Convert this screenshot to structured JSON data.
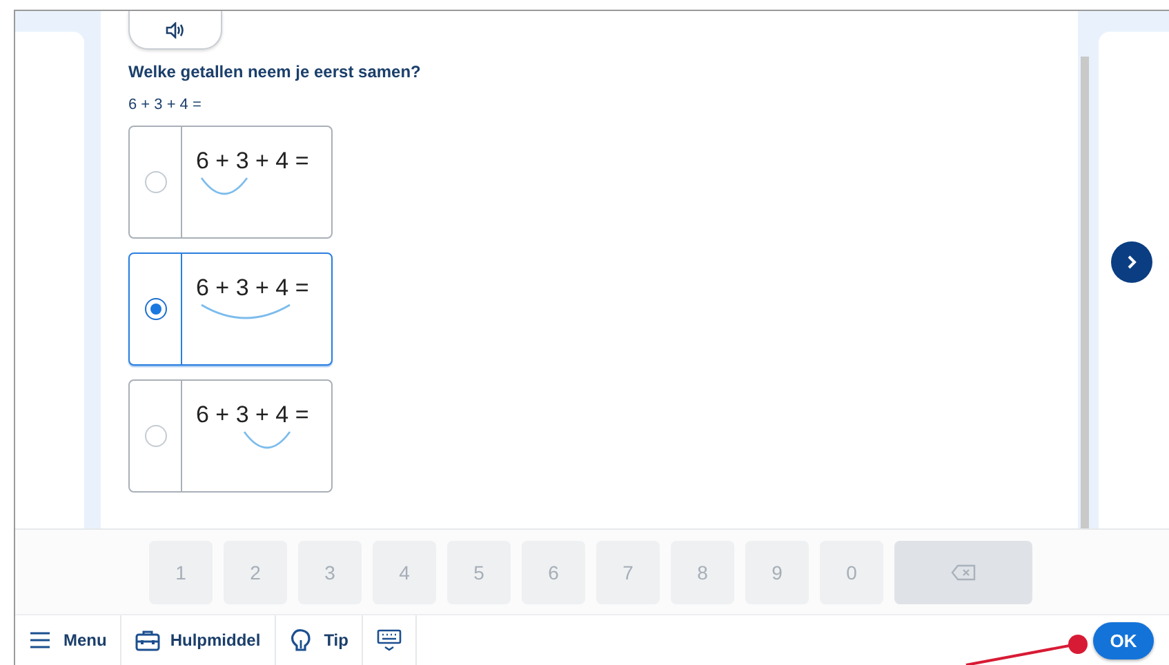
{
  "question": {
    "prompt": "Welke getallen neem je eerst samen?",
    "sum": "6 + 3 + 4 ="
  },
  "options": [
    {
      "equation": "6 + 3 + 4 =",
      "kind": "left",
      "selected": false
    },
    {
      "equation": "6 + 3 + 4 =",
      "kind": "wide",
      "selected": true
    },
    {
      "equation": "6 + 3 + 4 =",
      "kind": "right",
      "selected": false
    }
  ],
  "keypad": [
    "1",
    "2",
    "3",
    "4",
    "5",
    "6",
    "7",
    "8",
    "9",
    "0"
  ],
  "toolbar": [
    {
      "label": "Menu",
      "kind": "menu"
    },
    {
      "label": "Hulpmiddel",
      "kind": "toolbox"
    },
    {
      "label": "Tip",
      "kind": "tip"
    },
    {
      "kind": "keyboard"
    }
  ],
  "ok_button": "OK"
}
